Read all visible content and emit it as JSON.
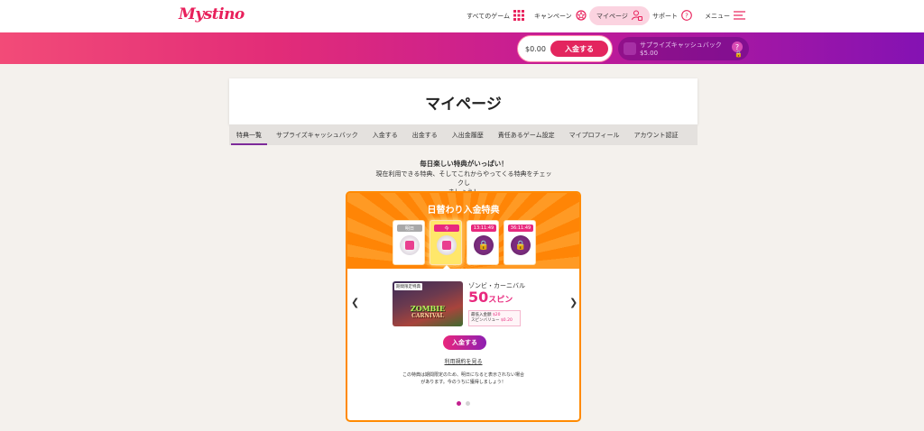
{
  "header": {
    "logo": "Mystino",
    "nav": {
      "games": "すべてのゲーム",
      "campaign": "キャンペーン",
      "mypage": "マイページ",
      "support": "サポート",
      "menu": "メニュー"
    }
  },
  "banner": {
    "balance": "$0.00",
    "deposit_label": "入金する",
    "cashback_title": "サプライズキャッシュバック",
    "cashback_value": "$5.00",
    "cashback_badge": "?"
  },
  "page": {
    "title": "マイページ",
    "tabs": [
      "特典一覧",
      "サプライズキャッシュバック",
      "入金する",
      "出金する",
      "入出金履歴",
      "責任あるゲーム設定",
      "マイプロフィール",
      "アカウント認証"
    ],
    "active_tab": 0,
    "intro_line1": "毎日楽しい特典がいっぱい！",
    "intro_line2": "現在利用できる特典、そしてこれからやってくる特典をチェックし",
    "intro_line3": "ましょう！"
  },
  "promo": {
    "title": "日替わり入金特典",
    "days": [
      {
        "label": "明日"
      },
      {
        "label": "今"
      },
      {
        "label": "13:11:49"
      },
      {
        "label": "36:11:49"
      }
    ],
    "game_tag": "期間限定特典",
    "game_logo_line1": "ZOMBIE",
    "game_logo_line2": "CARNIVAL",
    "game_name": "ゾンビ・カーニバル",
    "spins": "50",
    "spins_unit": "スピン",
    "min_deposit_label": "最低入金額",
    "min_deposit_value": "$20",
    "spin_value_label": "スピンバリュー",
    "spin_value_value": "$0.20",
    "deposit_label": "入金する",
    "terms_link": "利用規約を見る",
    "notice_line1": "この特典は期間限定のため、明日になると表示されない場合",
    "notice_line2": "があります。今のうちに獲得しましょう！"
  },
  "colors": {
    "brand": "#e8205b",
    "accent_purple": "#8412b3",
    "promo_orange": "#ff8a00"
  }
}
